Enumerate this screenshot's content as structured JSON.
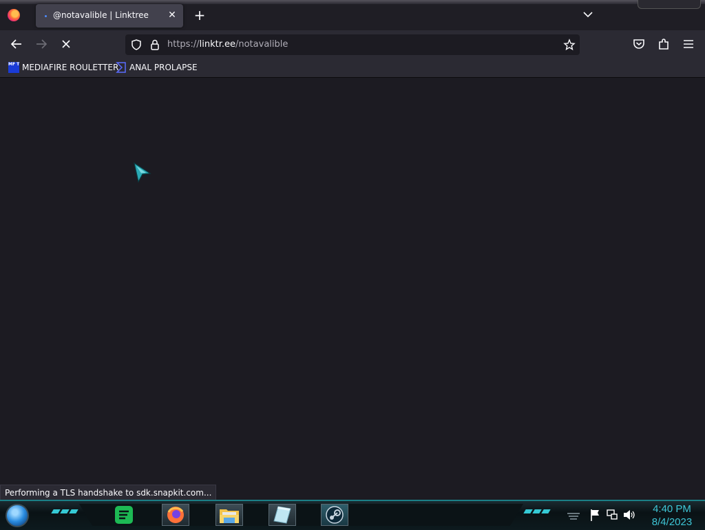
{
  "browser": {
    "tab": {
      "title": "@notavalible | Linktree",
      "close": "✕"
    },
    "new_tab": "+",
    "url": {
      "scheme": "https://",
      "host": "linktr.ee",
      "path": "/notavalible"
    },
    "bookmarks": [
      {
        "label": "MEDIAFIRE ROULETTER",
        "icon": "mft-icon",
        "icon_text": "MF T"
      },
      {
        "label": "ANAL PROLAPSE",
        "icon": "sigma-icon"
      }
    ],
    "status": "Performing a TLS handshake to sdk.snapkit.com..."
  },
  "taskbar": {
    "apps": [
      "spotify-icon",
      "firefox-icon",
      "file-explorer-icon",
      "notes-icon",
      "steam-icon"
    ],
    "clock": {
      "time": "4:40 PM",
      "date": "8/4/2023"
    }
  },
  "colors": {
    "accent": "#3ec6d6",
    "browser_bg": "#1c1b22",
    "toolbar": "#2b2a33"
  }
}
